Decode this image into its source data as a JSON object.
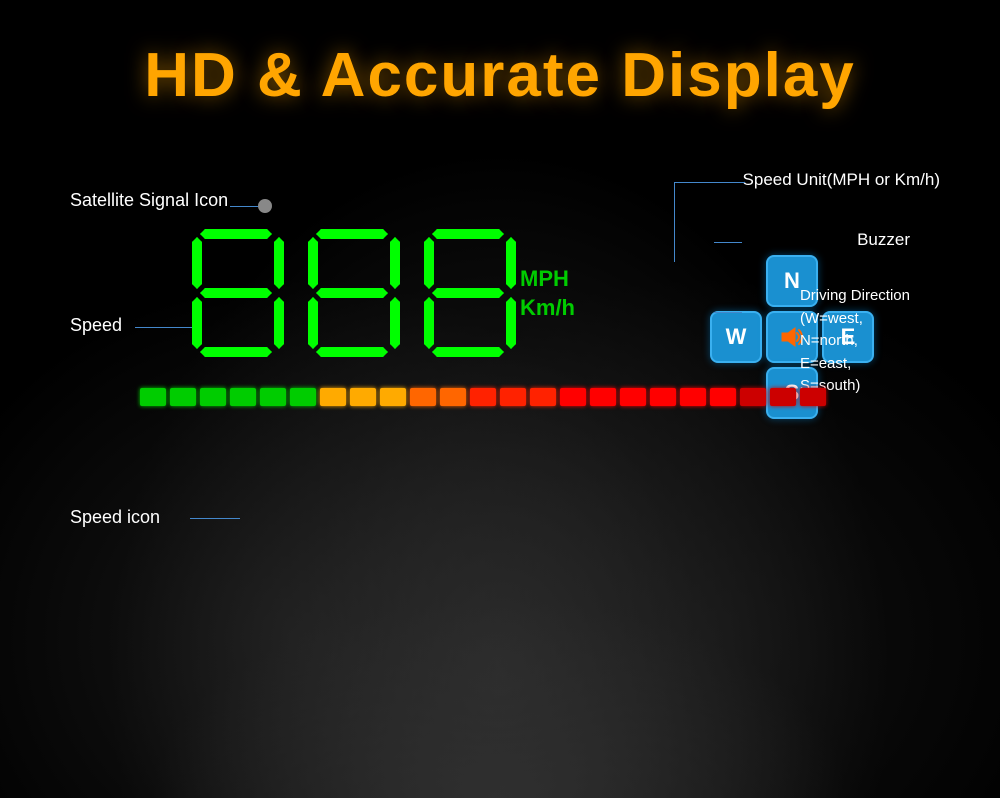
{
  "title": "HD & Accurate Display",
  "labels": {
    "satellite_signal": "Satellite Signal Icon",
    "speed": "Speed",
    "speed_icon": "Speed icon",
    "speed_unit_label": "Speed Unit(MPH or Km/h)",
    "buzzer": "Buzzer",
    "driving_direction": "Driving Direction\n(W=west,\nN=north,\nE=east,\nS=south)"
  },
  "display": {
    "digits": [
      "8",
      "8",
      "8"
    ],
    "unit_line1": "MPH",
    "unit_line2": "Km/h"
  },
  "compass": {
    "north": "N",
    "west": "W",
    "east": "E",
    "south": "S",
    "buzzer_icon": "🔊"
  },
  "speed_bar": {
    "colors": [
      "#00cc00",
      "#00cc00",
      "#00cc00",
      "#00cc00",
      "#00cc00",
      "#00cc00",
      "#ffaa00",
      "#ffaa00",
      "#ffaa00",
      "#ff6600",
      "#ff6600",
      "#ff2200",
      "#ff2200",
      "#ff2200",
      "#ff0000",
      "#ff0000",
      "#ff0000",
      "#ff0000",
      "#ff0000",
      "#ff0000",
      "#cc0000",
      "#cc0000",
      "#cc0000"
    ]
  },
  "colors": {
    "title": "#FFA500",
    "label_white": "#ffffff",
    "seg_green": "#00ff00",
    "line_blue": "#4488cc",
    "compass_bg": "#1a90d0",
    "unit_green": "#00cc00"
  }
}
